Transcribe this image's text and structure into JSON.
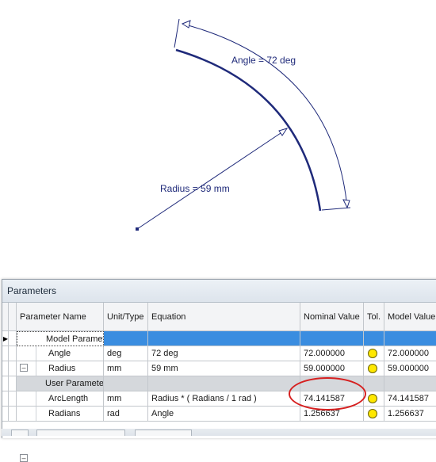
{
  "sketch": {
    "angle_label": "Angle = 72 deg",
    "radius_label": "Radius = 59 mm"
  },
  "panel": {
    "title": "Parameters",
    "columns": [
      "Parameter Name",
      "Unit/Type",
      "Equation",
      "Nominal Value",
      "Tol.",
      "Model Value"
    ],
    "groups": {
      "model": "Model Paramet...",
      "user": "User Parameters"
    },
    "rows": [
      {
        "name": "Angle",
        "unit": "deg",
        "equation": "72 deg",
        "nominal": "72.000000",
        "model": "72.000000"
      },
      {
        "name": "Radius",
        "unit": "mm",
        "equation": "59 mm",
        "nominal": "59.000000",
        "model": "59.000000"
      },
      {
        "name": "ArcLength",
        "unit": "mm",
        "equation": "Radius * ( Radians / 1 rad )",
        "nominal": "74.141587",
        "model": "74.141587"
      },
      {
        "name": "Radians",
        "unit": "rad",
        "equation": "Angle",
        "nominal": "1.256637",
        "model": "1.256637"
      }
    ],
    "colors": {
      "selection": "#3a8de0",
      "tolerance_dot": "#ffe800",
      "highlight": "#d62020",
      "dimension": "#1f2a7a"
    }
  }
}
